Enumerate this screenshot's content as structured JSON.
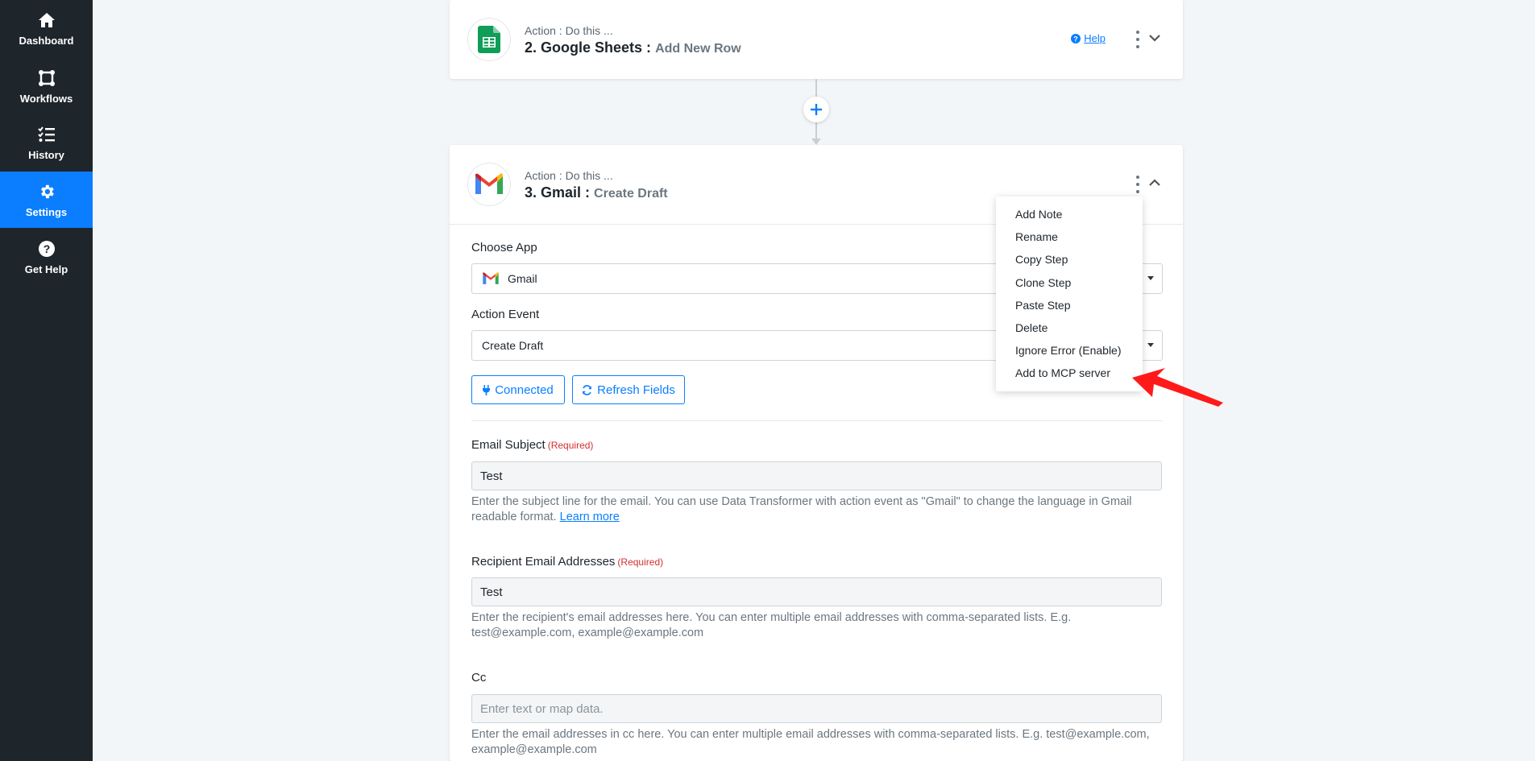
{
  "sidebar": {
    "items": [
      {
        "label": "Dashboard",
        "icon": "home-icon"
      },
      {
        "label": "Workflows",
        "icon": "workflow-icon"
      },
      {
        "label": "History",
        "icon": "history-icon"
      },
      {
        "label": "Settings",
        "icon": "gear-icon",
        "active": true
      },
      {
        "label": "Get Help",
        "icon": "question-icon"
      }
    ]
  },
  "step2": {
    "subtitle": "Action : Do this ...",
    "app": "2. Google Sheets :",
    "event": "Add New Row",
    "help_label": "Help",
    "icon": "google-sheets-icon"
  },
  "step3": {
    "subtitle": "Action : Do this ...",
    "app": "3. Gmail :",
    "event": "Create Draft",
    "icon": "gmail-icon"
  },
  "form": {
    "choose_app_label": "Choose App",
    "choose_app_value": "Gmail",
    "action_event_label": "Action Event",
    "action_event_value": "Create Draft",
    "connected_button": "Connected",
    "refresh_button": "Refresh Fields",
    "required_text": "(Required)",
    "email_subject_label": "Email Subject",
    "email_subject_value": "Test",
    "email_subject_help": "Enter the subject line for the email. You can use Data Transformer with action event as \"Gmail\" to change the language in Gmail readable format.",
    "learn_more": "Learn more",
    "recipient_label": "Recipient Email Addresses",
    "recipient_value": "Test",
    "recipient_help": "Enter the recipient's email addresses here. You can enter multiple email addresses with comma-separated lists. E.g. test@example.com, example@example.com",
    "cc_label": "Cc",
    "cc_placeholder": "Enter text or map data.",
    "cc_help": "Enter the email addresses in cc here. You can enter multiple email addresses with comma-separated lists. E.g. test@example.com, example@example.com"
  },
  "menu": {
    "items": [
      "Add Note",
      "Rename",
      "Copy Step",
      "Clone Step",
      "Paste Step",
      "Delete",
      "Ignore Error (Enable)",
      "Add to MCP server"
    ]
  },
  "colors": {
    "sidebar_bg": "#1e252b",
    "accent": "#0a7eff",
    "required": "#d32f2f",
    "annotation_arrow": "#ff1a1a"
  }
}
